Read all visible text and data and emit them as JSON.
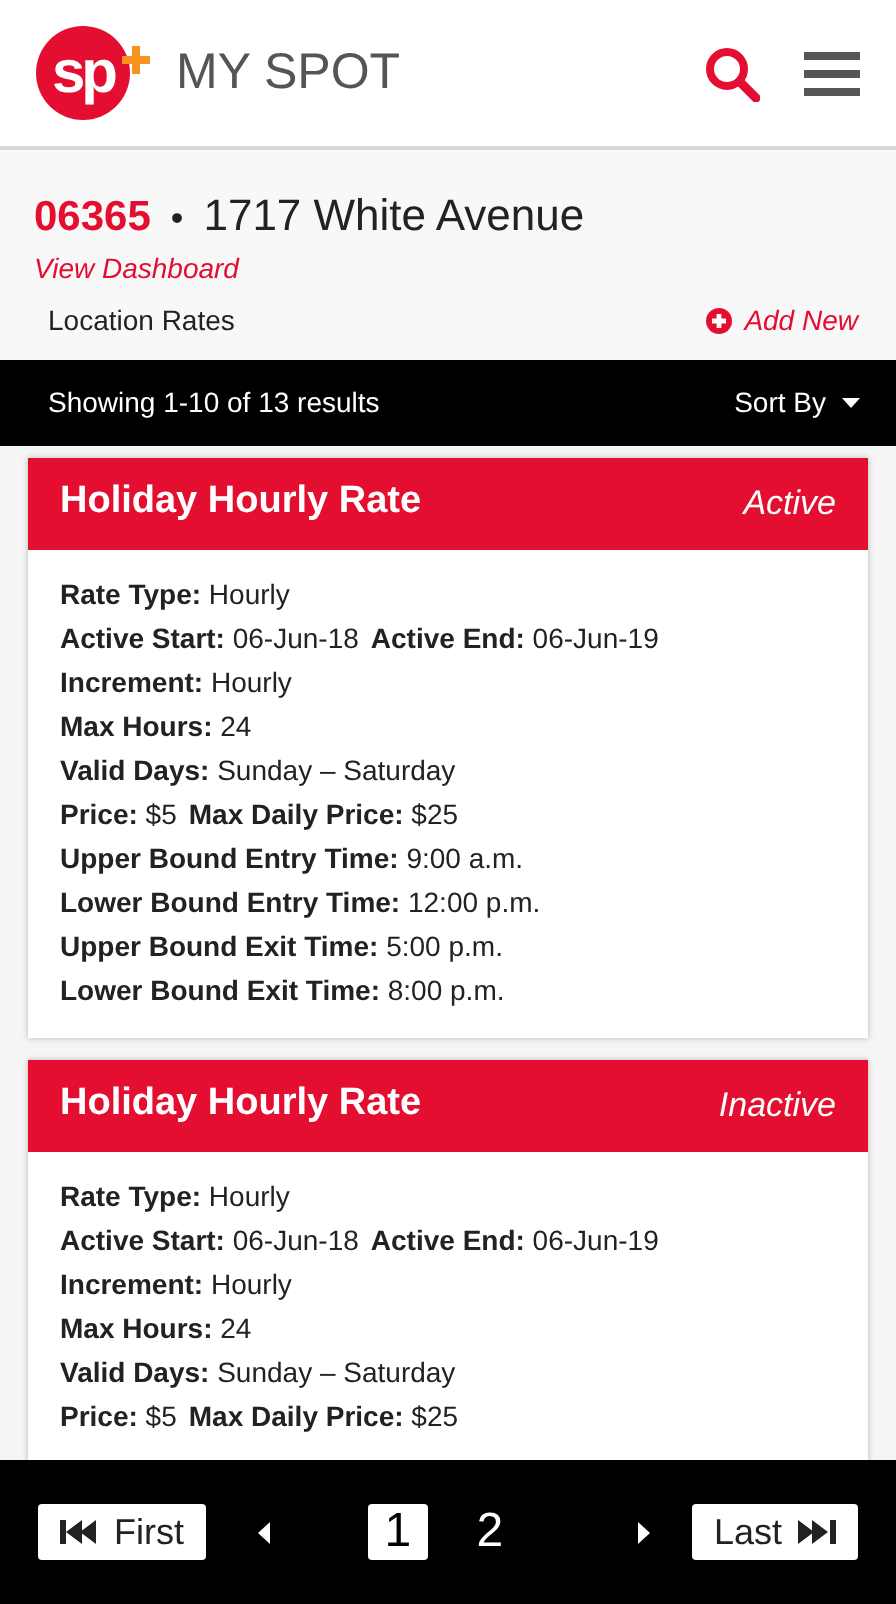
{
  "header": {
    "logo_text": "sp",
    "title": "MY SPOT"
  },
  "location": {
    "code": "06365",
    "separator": "•",
    "address": "1717 White Avenue",
    "dashboard_link": "View Dashboard",
    "section": "Location Rates",
    "add_new": "Add New"
  },
  "results_bar": {
    "summary": "Showing 1-10 of 13 results",
    "sort": "Sort By"
  },
  "rates": [
    {
      "title": "Holiday Hourly Rate",
      "status": "Active",
      "lines": [
        [
          "**Rate Type:** Hourly"
        ],
        [
          "**Active Start:** 06-Jun-18",
          "**Active End:** 06-Jun-19"
        ],
        [
          "**Increment:** Hourly"
        ],
        [
          "**Max Hours:** 24"
        ],
        [
          "**Valid Days:** Sunday – Saturday"
        ],
        [
          "**Price:** $5",
          "**Max Daily Price:** $25"
        ],
        [
          "**Upper Bound Entry Time:** 9:00 a.m."
        ],
        [
          "**Lower Bound Entry Time:** 12:00 p.m."
        ],
        [
          "**Upper Bound Exit Time:** 5:00 p.m."
        ],
        [
          "**Lower Bound Exit Time:** 8:00 p.m."
        ]
      ]
    },
    {
      "title": "Holiday Hourly Rate",
      "status": "Inactive",
      "lines": [
        [
          "**Rate Type:** Hourly"
        ],
        [
          "**Active Start:** 06-Jun-18",
          "**Active End:** 06-Jun-19"
        ],
        [
          "**Increment:** Hourly"
        ],
        [
          "**Max Hours:** 24"
        ],
        [
          "**Valid Days:** Sunday – Saturday"
        ],
        [
          "**Price:** $5",
          "**Max Daily Price:** $25"
        ]
      ]
    }
  ],
  "pagination": {
    "first": "First",
    "last": "Last",
    "pages": [
      {
        "label": "1",
        "selected": true
      },
      {
        "label": "2",
        "selected": false
      }
    ]
  }
}
